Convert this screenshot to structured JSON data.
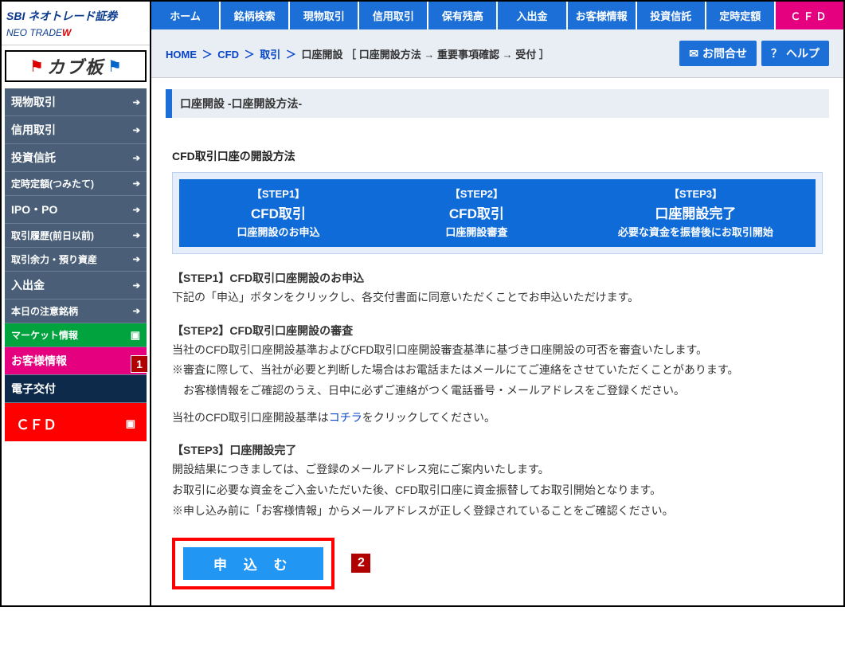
{
  "logo": {
    "brand": "SBI ネオトレード証券",
    "sub": "NEO TRADE",
    "sub_suffix": "W"
  },
  "kabu_banner": "カブ板",
  "sidebar": {
    "items": [
      {
        "label": "現物取引",
        "cls": ""
      },
      {
        "label": "信用取引",
        "cls": ""
      },
      {
        "label": "投資信託",
        "cls": ""
      },
      {
        "label": "定時定額(つみたて)",
        "cls": "small"
      },
      {
        "label": "IPO・PO",
        "cls": ""
      },
      {
        "label": "取引履歴(前日以前)",
        "cls": "small"
      },
      {
        "label": "取引余力・預り資産",
        "cls": "small"
      },
      {
        "label": "入出金",
        "cls": ""
      },
      {
        "label": "本日の注意銘柄",
        "cls": "small"
      },
      {
        "label": "マーケット情報",
        "cls": "green small",
        "icon": "doc"
      },
      {
        "label": "お客様情報",
        "cls": "pink",
        "icon": "note"
      },
      {
        "label": "電子交付",
        "cls": "navy"
      }
    ],
    "active": {
      "label": "ＣＦＤ",
      "icon": "doc"
    }
  },
  "annotations": {
    "one": "1",
    "two": "2"
  },
  "topnav": [
    "ホーム",
    "銘柄検索",
    "現物取引",
    "信用取引",
    "保有残高",
    "入出金",
    "お客様情報",
    "投資信託",
    "定時定額",
    "ＣＦＤ"
  ],
  "breadcrumb": {
    "home": "HOME",
    "cfd": "CFD",
    "torihiki": "取引",
    "label": "口座開設",
    "steps": "［ 口座開設方法 → 重要事項確認 → 受付 ］"
  },
  "header_buttons": {
    "contact": "お問合せ",
    "help": "ヘルプ"
  },
  "section_title": "口座開設 -口座開設方法-",
  "content": {
    "heading": "CFD取引口座の開設方法",
    "steps": [
      {
        "t": "【STEP1】",
        "m": "CFD取引",
        "b": "口座開設のお申込"
      },
      {
        "t": "【STEP2】",
        "m": "CFD取引",
        "b": "口座開設審査"
      },
      {
        "t": "【STEP3】",
        "m": "口座開設完了",
        "b": "必要な資金を振替後にお取引開始"
      }
    ],
    "s1_head": "【STEP1】CFD取引口座開設のお申込",
    "s1_body": "下記の「申込」ボタンをクリックし、各交付書面に同意いただくことでお申込いただけます。",
    "s2_head": "【STEP2】CFD取引口座開設の審査",
    "s2_l1": "当社のCFD取引口座開設基準およびCFD取引口座開設審査基準に基づき口座開設の可否を審査いたします。",
    "s2_l2": "※審査に際して、当社が必要と判断した場合はお電話またはメールにてご連絡をさせていただくことがあります。",
    "s2_l3": "　お客様情報をご確認のうえ、日中に必ずご連絡がつく電話番号・メールアドレスをご登録ください。",
    "s2_l4a": "当社のCFD取引口座開設基準は",
    "s2_link": "コチラ",
    "s2_l4b": "をクリックしてください。",
    "s3_head": "【STEP3】口座開設完了",
    "s3_l1": "開設結果につきましては、ご登録のメールアドレス宛にご案内いたします。",
    "s3_l2": "お取引に必要な資金をご入金いただいた後、CFD取引口座に資金振替してお取引開始となります。",
    "s3_l3": "※申し込み前に「お客様情報」からメールアドレスが正しく登録されていることをご確認ください。",
    "apply_label": "申 込 む"
  }
}
